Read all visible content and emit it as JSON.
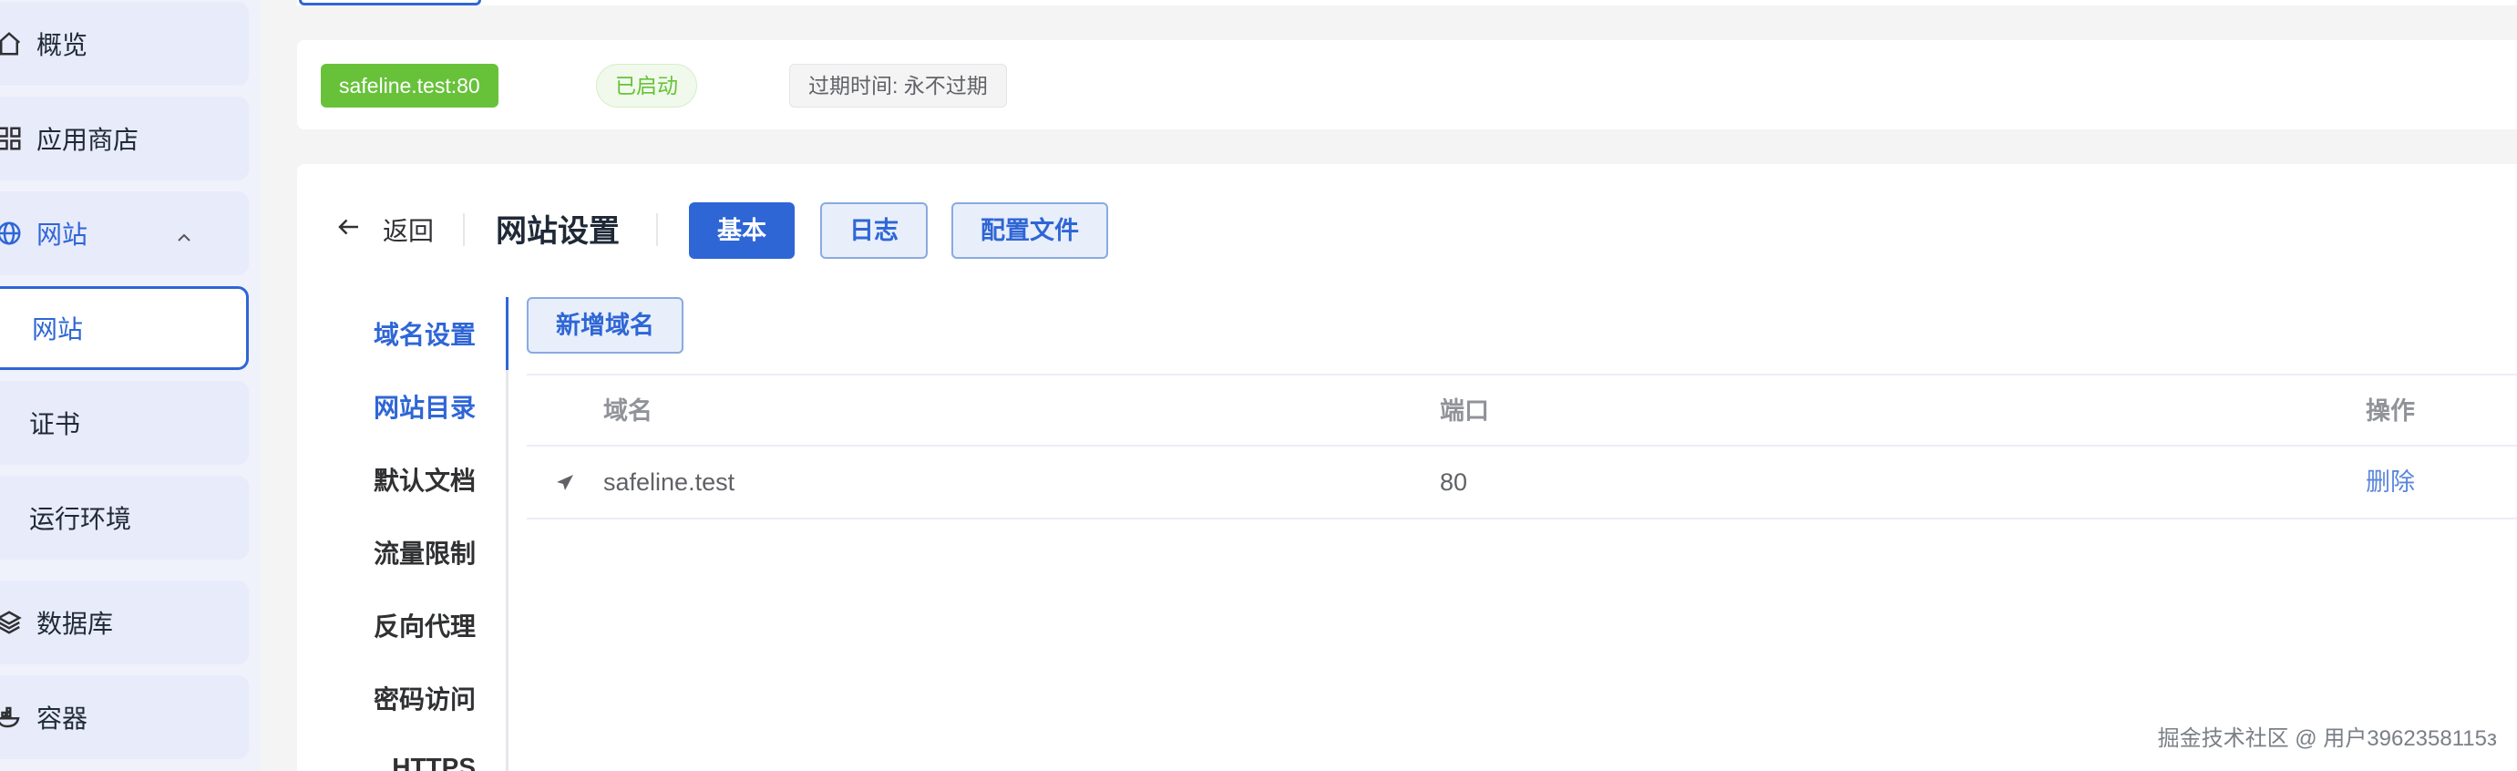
{
  "sidebar": {
    "items": [
      {
        "label": "概览",
        "icon": "home-icon"
      },
      {
        "label": "应用商店",
        "icon": "grid-icon"
      },
      {
        "label": "网站",
        "icon": "globe-icon"
      },
      {
        "label": "数据库",
        "icon": "layers-icon"
      },
      {
        "label": "容器",
        "icon": "docker-icon"
      }
    ],
    "sub_items": [
      {
        "label": "网站"
      },
      {
        "label": "证书"
      },
      {
        "label": "运行环境"
      }
    ]
  },
  "status": {
    "domain": "safeline.test:80",
    "state": "已启动",
    "expire": "过期时间: 永不过期"
  },
  "header": {
    "back": "返回",
    "title": "网站设置",
    "tabs": [
      {
        "label": "基本",
        "active": true
      },
      {
        "label": "日志"
      },
      {
        "label": "配置文件"
      }
    ]
  },
  "submenu": {
    "items": [
      {
        "label": "域名设置"
      },
      {
        "label": "网站目录"
      },
      {
        "label": "默认文档"
      },
      {
        "label": "流量限制"
      },
      {
        "label": "反向代理"
      },
      {
        "label": "密码访问"
      },
      {
        "label": "HTTPS"
      }
    ]
  },
  "content": {
    "add_button": "新增域名",
    "columns": {
      "domain": "域名",
      "port": "端口",
      "action": "操作"
    },
    "rows": [
      {
        "domain": "safeline.test",
        "port": "80",
        "action": "删除"
      }
    ]
  },
  "watermark": "掘金技术社区 @ 用户3962358115з",
  "colors": {
    "primary": "#2f66d6",
    "success": "#67c23a",
    "link": "#5b86dd"
  }
}
